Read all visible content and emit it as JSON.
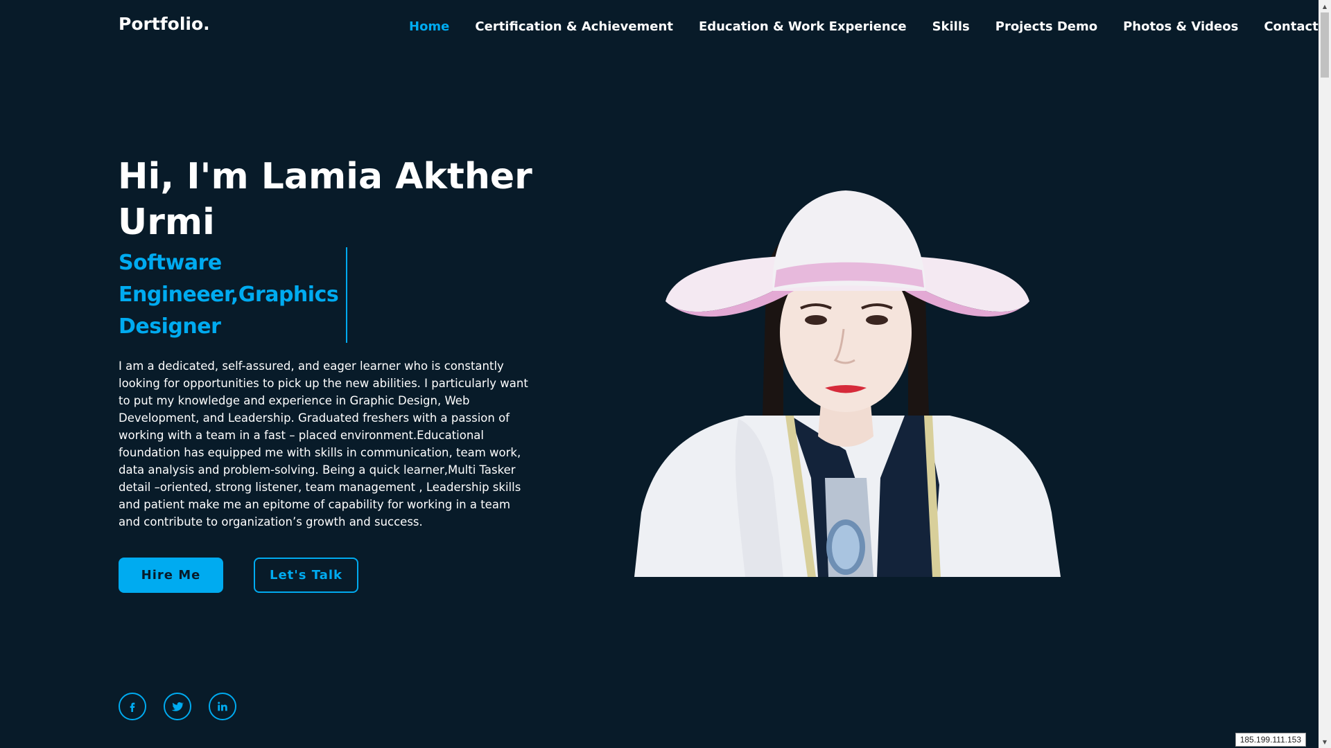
{
  "header": {
    "logo": "Portfolio.",
    "nav": [
      {
        "label": "Home",
        "active": true
      },
      {
        "label": "Certification & Achievement",
        "active": false
      },
      {
        "label": "Education & Work Experience",
        "active": false
      },
      {
        "label": "Skills",
        "active": false
      },
      {
        "label": "Projects Demo",
        "active": false
      },
      {
        "label": "Photos & Videos",
        "active": false
      },
      {
        "label": "Contact",
        "active": false
      }
    ]
  },
  "hero": {
    "title": "Hi, I'm Lamia Akther Urmi",
    "role": "Software Engineeer,Graphics Designer",
    "bio": "I am a dedicated, self-assured, and eager learner who is constantly looking for opportunities to pick up the new abilities. I particularly want to put my knowledge and experience in Graphic Design, Web Development, and Leadership. Graduated freshers with a passion of working with a team in a fast – placed environment.Educational foundation has equipped me with skills in communication, team work, data analysis and problem-solving. Being a quick learner,Multi Tasker detail –oriented, strong listener, team management , Leadership skills and patient make me an epitome of capability for working in a team and contribute to organization’s growth and success.",
    "hire_label": "Hire Me",
    "talk_label": "Let's Talk"
  },
  "socials": [
    {
      "icon": "facebook-icon"
    },
    {
      "icon": "twitter-icon"
    },
    {
      "icon": "linkedin-icon"
    }
  ],
  "status": {
    "ip": "185.199.111.153"
  },
  "colors": {
    "background": "#081b29",
    "accent": "#00abf0",
    "text": "#ffffff"
  }
}
